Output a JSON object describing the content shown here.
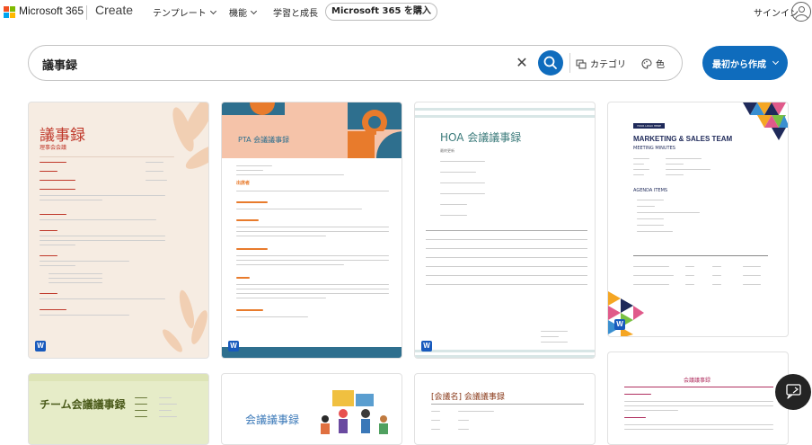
{
  "header": {
    "brand": "Microsoft 365",
    "create": "Create",
    "nav": [
      "テンプレート",
      "機能",
      "学習と成長"
    ],
    "buy_label": "Microsoft 365 を購入",
    "signin": "サインイン",
    "icons": [
      "microsoft-logo",
      "chevron-down-icon",
      "user-icon"
    ]
  },
  "search": {
    "query": "議事録",
    "category_label": "カテゴリ",
    "color_label": "色",
    "create_label": "最初から作成"
  },
  "cards": [
    {
      "title": "議事録",
      "subtitle": "理事会会議",
      "heading": "",
      "accent": "#c0392b"
    },
    {
      "title": "PTA 会議議事録",
      "subtitle": "",
      "heading": "出席者",
      "accent": "#2e6f8e"
    },
    {
      "title": "HOA 会議議事録",
      "subtitle": "最終更新",
      "heading": "",
      "accent": "#3a7a7a"
    },
    {
      "title": "MARKETING & SALES TEAM",
      "subtitle": "MEETING MINUTES",
      "heading": "AGENDA ITEMS",
      "logo": "YOUR LOGO HERE",
      "accent": "#1f2a5a"
    },
    {
      "title": "チーム会議議事録",
      "subtitle": "",
      "heading": "",
      "accent": "#4a5a1a"
    },
    {
      "title": "会議議事録",
      "subtitle": "",
      "heading": "",
      "accent": "#3a78b8"
    },
    {
      "title": "[会議名] 会議議事録",
      "subtitle": "",
      "heading": "",
      "accent": "#8a3a1a"
    },
    {
      "title": "会議議事録",
      "subtitle": "",
      "heading": "",
      "accent": "#b03060"
    }
  ],
  "word_badge": "W",
  "colors": {
    "primary": "#0f6cbd",
    "ms_red": "#f25022",
    "ms_green": "#7fba00",
    "ms_blue": "#00a4ef",
    "ms_yellow": "#ffb900"
  }
}
